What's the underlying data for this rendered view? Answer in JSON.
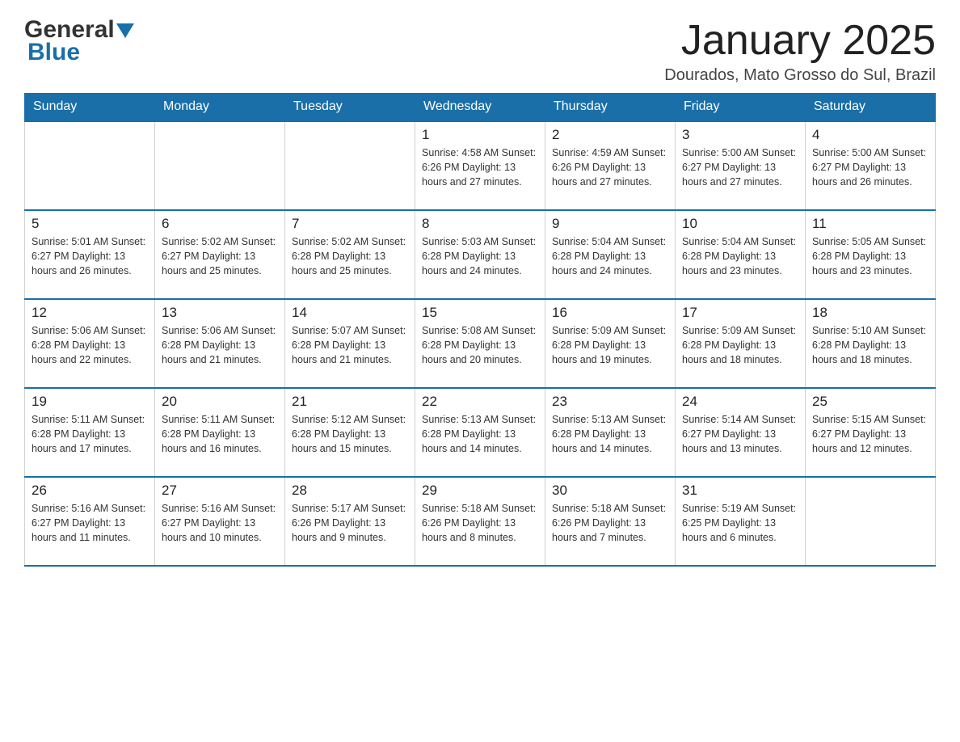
{
  "header": {
    "logo_general": "General",
    "logo_blue": "Blue",
    "month_title": "January 2025",
    "location": "Dourados, Mato Grosso do Sul, Brazil"
  },
  "days_of_week": [
    "Sunday",
    "Monday",
    "Tuesday",
    "Wednesday",
    "Thursday",
    "Friday",
    "Saturday"
  ],
  "weeks": [
    [
      {
        "day": "",
        "info": ""
      },
      {
        "day": "",
        "info": ""
      },
      {
        "day": "",
        "info": ""
      },
      {
        "day": "1",
        "info": "Sunrise: 4:58 AM\nSunset: 6:26 PM\nDaylight: 13 hours\nand 27 minutes."
      },
      {
        "day": "2",
        "info": "Sunrise: 4:59 AM\nSunset: 6:26 PM\nDaylight: 13 hours\nand 27 minutes."
      },
      {
        "day": "3",
        "info": "Sunrise: 5:00 AM\nSunset: 6:27 PM\nDaylight: 13 hours\nand 27 minutes."
      },
      {
        "day": "4",
        "info": "Sunrise: 5:00 AM\nSunset: 6:27 PM\nDaylight: 13 hours\nand 26 minutes."
      }
    ],
    [
      {
        "day": "5",
        "info": "Sunrise: 5:01 AM\nSunset: 6:27 PM\nDaylight: 13 hours\nand 26 minutes."
      },
      {
        "day": "6",
        "info": "Sunrise: 5:02 AM\nSunset: 6:27 PM\nDaylight: 13 hours\nand 25 minutes."
      },
      {
        "day": "7",
        "info": "Sunrise: 5:02 AM\nSunset: 6:28 PM\nDaylight: 13 hours\nand 25 minutes."
      },
      {
        "day": "8",
        "info": "Sunrise: 5:03 AM\nSunset: 6:28 PM\nDaylight: 13 hours\nand 24 minutes."
      },
      {
        "day": "9",
        "info": "Sunrise: 5:04 AM\nSunset: 6:28 PM\nDaylight: 13 hours\nand 24 minutes."
      },
      {
        "day": "10",
        "info": "Sunrise: 5:04 AM\nSunset: 6:28 PM\nDaylight: 13 hours\nand 23 minutes."
      },
      {
        "day": "11",
        "info": "Sunrise: 5:05 AM\nSunset: 6:28 PM\nDaylight: 13 hours\nand 23 minutes."
      }
    ],
    [
      {
        "day": "12",
        "info": "Sunrise: 5:06 AM\nSunset: 6:28 PM\nDaylight: 13 hours\nand 22 minutes."
      },
      {
        "day": "13",
        "info": "Sunrise: 5:06 AM\nSunset: 6:28 PM\nDaylight: 13 hours\nand 21 minutes."
      },
      {
        "day": "14",
        "info": "Sunrise: 5:07 AM\nSunset: 6:28 PM\nDaylight: 13 hours\nand 21 minutes."
      },
      {
        "day": "15",
        "info": "Sunrise: 5:08 AM\nSunset: 6:28 PM\nDaylight: 13 hours\nand 20 minutes."
      },
      {
        "day": "16",
        "info": "Sunrise: 5:09 AM\nSunset: 6:28 PM\nDaylight: 13 hours\nand 19 minutes."
      },
      {
        "day": "17",
        "info": "Sunrise: 5:09 AM\nSunset: 6:28 PM\nDaylight: 13 hours\nand 18 minutes."
      },
      {
        "day": "18",
        "info": "Sunrise: 5:10 AM\nSunset: 6:28 PM\nDaylight: 13 hours\nand 18 minutes."
      }
    ],
    [
      {
        "day": "19",
        "info": "Sunrise: 5:11 AM\nSunset: 6:28 PM\nDaylight: 13 hours\nand 17 minutes."
      },
      {
        "day": "20",
        "info": "Sunrise: 5:11 AM\nSunset: 6:28 PM\nDaylight: 13 hours\nand 16 minutes."
      },
      {
        "day": "21",
        "info": "Sunrise: 5:12 AM\nSunset: 6:28 PM\nDaylight: 13 hours\nand 15 minutes."
      },
      {
        "day": "22",
        "info": "Sunrise: 5:13 AM\nSunset: 6:28 PM\nDaylight: 13 hours\nand 14 minutes."
      },
      {
        "day": "23",
        "info": "Sunrise: 5:13 AM\nSunset: 6:28 PM\nDaylight: 13 hours\nand 14 minutes."
      },
      {
        "day": "24",
        "info": "Sunrise: 5:14 AM\nSunset: 6:27 PM\nDaylight: 13 hours\nand 13 minutes."
      },
      {
        "day": "25",
        "info": "Sunrise: 5:15 AM\nSunset: 6:27 PM\nDaylight: 13 hours\nand 12 minutes."
      }
    ],
    [
      {
        "day": "26",
        "info": "Sunrise: 5:16 AM\nSunset: 6:27 PM\nDaylight: 13 hours\nand 11 minutes."
      },
      {
        "day": "27",
        "info": "Sunrise: 5:16 AM\nSunset: 6:27 PM\nDaylight: 13 hours\nand 10 minutes."
      },
      {
        "day": "28",
        "info": "Sunrise: 5:17 AM\nSunset: 6:26 PM\nDaylight: 13 hours\nand 9 minutes."
      },
      {
        "day": "29",
        "info": "Sunrise: 5:18 AM\nSunset: 6:26 PM\nDaylight: 13 hours\nand 8 minutes."
      },
      {
        "day": "30",
        "info": "Sunrise: 5:18 AM\nSunset: 6:26 PM\nDaylight: 13 hours\nand 7 minutes."
      },
      {
        "day": "31",
        "info": "Sunrise: 5:19 AM\nSunset: 6:25 PM\nDaylight: 13 hours\nand 6 minutes."
      },
      {
        "day": "",
        "info": ""
      }
    ]
  ]
}
